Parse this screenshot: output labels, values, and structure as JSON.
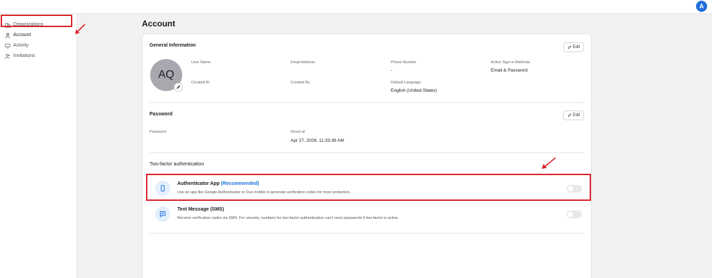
{
  "topbar": {
    "avatar_initial": "A"
  },
  "sidebar": {
    "items": [
      {
        "label": "Organizations",
        "icon": "organizations-icon"
      },
      {
        "label": "Account",
        "icon": "user-icon",
        "active": true
      },
      {
        "label": "Activity",
        "icon": "monitor-icon"
      },
      {
        "label": "Invitations",
        "icon": "add-user-icon"
      }
    ]
  },
  "page": {
    "title": "Account"
  },
  "general": {
    "title": "General Information",
    "edit_label": "Edit",
    "avatar_initials": "AQ",
    "fields": {
      "user_name_label": "User Name",
      "email_label": "Email Address",
      "phone_label": "Phone Number",
      "phone_value": "-",
      "signin_label": "Active Sign-in Methods",
      "signin_value": "Email & Password",
      "created_at_label": "Created At",
      "created_by_label": "Created By",
      "language_label": "Default Language",
      "language_value": "English (United States)"
    }
  },
  "password": {
    "title": "Password",
    "edit_label": "Edit",
    "password_label": "Password",
    "reset_label": "Reset at",
    "reset_value": "Apr 27, 2026, 11:33:38 AM"
  },
  "two_factor": {
    "title": "Two-factor authentication",
    "methods": [
      {
        "title": "Authenticator App",
        "badge": "(Recommended)",
        "description": "Use an app like Google Authenticator or Duo mobile to generate verification codes for more protection.",
        "enabled": false
      },
      {
        "title": "Text Message (SMS)",
        "badge": "",
        "description": "Receive verification codes via SMS. For security, numbers for two-factor authentication can't reset passwords if two-factor is active.",
        "enabled": false
      }
    ]
  },
  "colors": {
    "accent": "#1f6fdc",
    "highlight": "#d9232a"
  }
}
